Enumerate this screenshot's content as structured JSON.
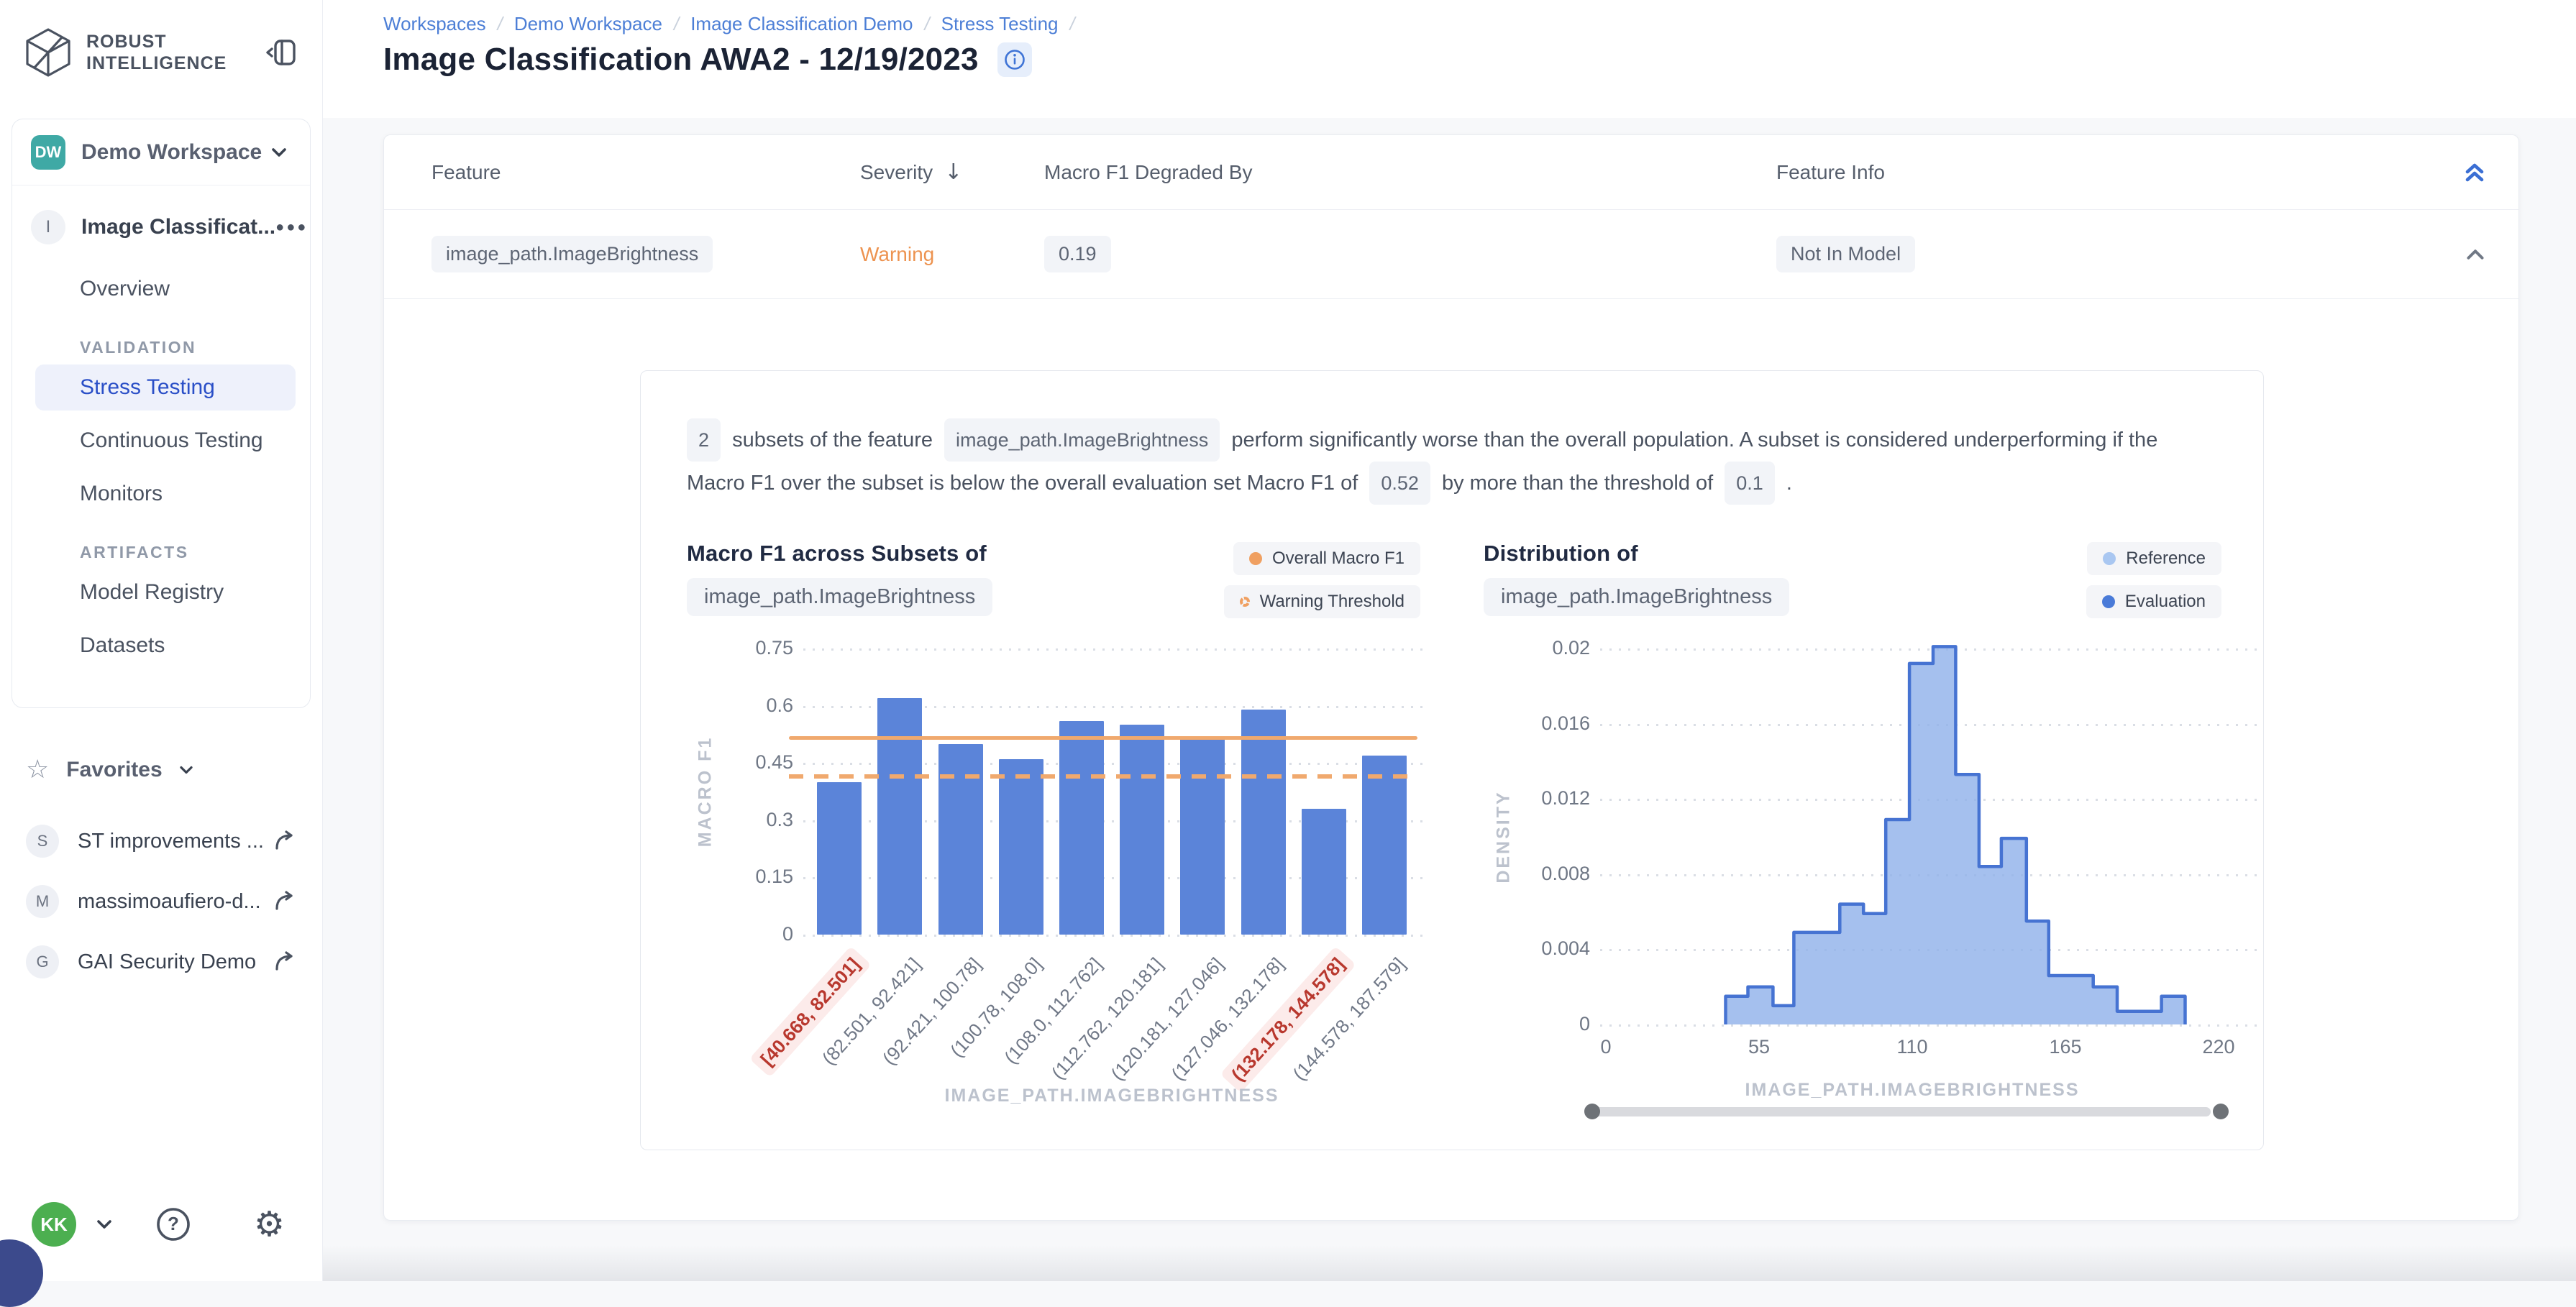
{
  "sidebar": {
    "logo_line1": "ROBUST",
    "logo_line2": "INTELLIGENCE",
    "workspace": {
      "initials": "DW",
      "name": "Demo Workspace"
    },
    "project": {
      "initial": "I",
      "name": "Image Classificat..."
    },
    "nav": [
      {
        "type": "item",
        "label": "Overview"
      },
      {
        "type": "section",
        "label": "VALIDATION"
      },
      {
        "type": "item",
        "label": "Stress Testing",
        "active": true
      },
      {
        "type": "item",
        "label": "Continuous Testing"
      },
      {
        "type": "item",
        "label": "Monitors"
      },
      {
        "type": "section",
        "label": "ARTIFACTS"
      },
      {
        "type": "item",
        "label": "Model Registry"
      },
      {
        "type": "item",
        "label": "Datasets"
      }
    ],
    "favorites": {
      "label": "Favorites",
      "items": [
        {
          "initial": "S",
          "name": "ST improvements ..."
        },
        {
          "initial": "M",
          "name": "massimoaufiero-d..."
        },
        {
          "initial": "G",
          "name": "GAI Security Demo"
        }
      ]
    },
    "user": {
      "initials": "KK"
    }
  },
  "header": {
    "breadcrumbs": [
      "Workspaces",
      "Demo Workspace",
      "Image Classification Demo",
      "Stress Testing"
    ],
    "title": "Image Classification AWA2 - 12/19/2023"
  },
  "table": {
    "columns": [
      "Feature",
      "Severity",
      "Macro F1 Degraded By",
      "Feature Info"
    ],
    "row": {
      "feature": "image_path.ImageBrightness",
      "severity": "Warning",
      "degraded_by": "0.19",
      "feature_info": "Not In Model"
    }
  },
  "detail": {
    "summary": [
      "2",
      " subsets of the feature ",
      "image_path.ImageBrightness",
      " perform significantly worse than the overall population. A subset is considered underperforming if the Macro F1 over the subset is below the overall evaluation set Macro F1 of ",
      "0.52",
      " by more than the threshold of ",
      "0.1",
      " ."
    ]
  },
  "chart_data": [
    {
      "type": "bar",
      "title": "Macro F1 across Subsets of",
      "title_chip": "image_path.ImageBrightness",
      "xlabel": "IMAGE_PATH.IMAGEBRIGHTNESS",
      "ylabel": "MACRO F1",
      "ylim": [
        0,
        0.75
      ],
      "yticks": [
        0,
        0.15,
        0.3,
        0.45,
        0.6,
        0.75
      ],
      "categories": [
        "[40.668, 82.501]",
        "(82.501, 92.421]",
        "(92.421, 100.78]",
        "(100.78, 108.0]",
        "(108.0, 112.762]",
        "(112.762, 120.181]",
        "(120.181, 127.046]",
        "(127.046, 132.178]",
        "(132.178, 144.578]",
        "(144.578, 187.579]"
      ],
      "values": [
        0.4,
        0.62,
        0.5,
        0.46,
        0.56,
        0.55,
        0.52,
        0.59,
        0.33,
        0.47
      ],
      "flagged_categories": [
        "[40.668, 82.501]",
        "(132.178, 144.578]"
      ],
      "reference_lines": [
        {
          "name": "Overall Macro F1",
          "value": 0.52,
          "style": "solid"
        },
        {
          "name": "Warning Threshold",
          "value": 0.42,
          "style": "dashed"
        }
      ],
      "legend": [
        {
          "label": "Overall Macro F1",
          "marker": "solid",
          "color": "#f0a061"
        },
        {
          "label": "Warning Threshold",
          "marker": "dashed",
          "color": "#f0a061"
        }
      ],
      "bar_color": "#5b84d9",
      "grid": true,
      "legend_position": "top-right"
    },
    {
      "type": "area",
      "title": "Distribution of",
      "title_chip": "image_path.ImageBrightness",
      "xlabel": "IMAGE_PATH.IMAGEBRIGHTNESS",
      "ylabel": "DENSITY",
      "xlim": [
        0,
        220
      ],
      "ylim": [
        0,
        0.02
      ],
      "yticks": [
        0,
        0.004,
        0.008,
        0.012,
        0.016,
        0.02
      ],
      "xticks": [
        0,
        55,
        110,
        165,
        220
      ],
      "bin_edges": [
        43,
        51,
        60,
        67.5,
        84,
        92.5,
        100.5,
        109,
        117.5,
        125.6,
        134,
        142,
        151,
        159,
        175,
        183.6,
        199.5,
        208
      ],
      "densities": [
        0.0015,
        0.002,
        0.001,
        0.0049,
        0.0064,
        0.0059,
        0.0109,
        0.0192,
        0.0201,
        0.0133,
        0.0084,
        0.0099,
        0.0055,
        0.0026,
        0.002,
        0.0007,
        0.0015
      ],
      "legend": [
        {
          "label": "Reference",
          "marker": "solid",
          "color": "#a9c7f1"
        },
        {
          "label": "Evaluation",
          "marker": "solid",
          "color": "#4a7bd8"
        }
      ],
      "fill_color": "#8fb0ea",
      "stroke_color": "#4673d2",
      "grid": true,
      "has_range_slider": true,
      "legend_position": "top-right"
    }
  ]
}
